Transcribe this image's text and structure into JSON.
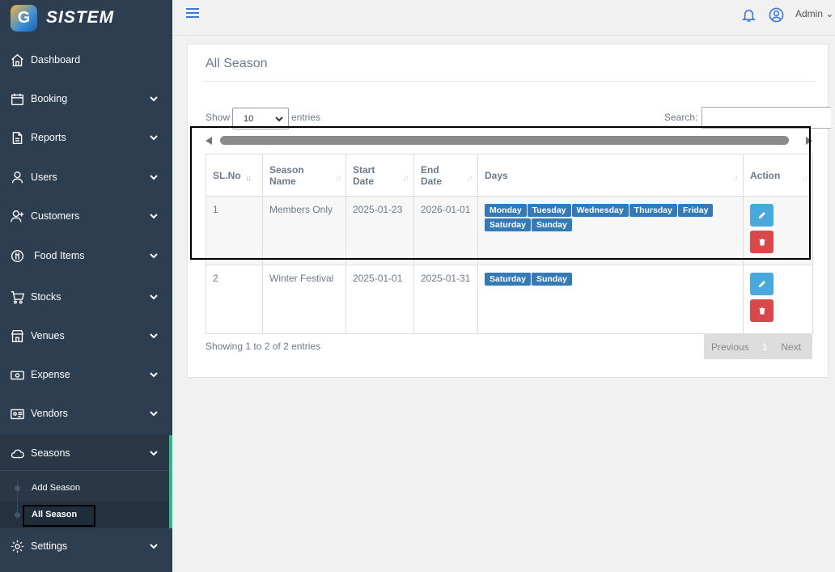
{
  "brand": {
    "logo_letter": "G",
    "name": "SISTEM"
  },
  "sidebar": {
    "items": [
      {
        "label": "Dashboard",
        "icon": "home-icon"
      },
      {
        "label": "Booking",
        "icon": "calendar-icon"
      },
      {
        "label": "Reports",
        "icon": "document-icon"
      },
      {
        "label": "Users",
        "icon": "user-icon"
      },
      {
        "label": "Customers",
        "icon": "user-plus-icon"
      },
      {
        "label": "Food Items",
        "icon": "food-icon"
      },
      {
        "label": "Stocks",
        "icon": "cart-icon"
      },
      {
        "label": "Venues",
        "icon": "store-icon"
      },
      {
        "label": "Expense",
        "icon": "money-icon"
      },
      {
        "label": "Vendors",
        "icon": "id-card-icon"
      },
      {
        "label": "Seasons",
        "icon": "cloud-icon"
      },
      {
        "label": "Settings",
        "icon": "gear-icon"
      }
    ],
    "seasons_sub": [
      "Add Season",
      "All Season"
    ]
  },
  "topbar": {
    "user_label": "Admin"
  },
  "page": {
    "title": "All Season",
    "show_label": "Show",
    "page_size": "10",
    "entries_label": "entries",
    "search_label": "Search:"
  },
  "table": {
    "headers": {
      "sl_no": "SL.No",
      "season_name_1": "Season",
      "season_name_2": "Name",
      "start_date_1": "Start",
      "start_date_2": "Date",
      "end_date_1": "End",
      "end_date_2": "Date",
      "days": "Days",
      "action": "Action"
    },
    "rows": [
      {
        "sl": "1",
        "name": "Members Only",
        "start": "2025-01-23",
        "end": "2026-01-01",
        "days": [
          "Monday",
          "Tuesday",
          "Wednesday",
          "Thursday",
          "Friday",
          "Saturday",
          "Sunday"
        ]
      },
      {
        "sl": "2",
        "name": "Winter Festival",
        "start": "2025-01-01",
        "end": "2025-01-31",
        "days": [
          "Saturday",
          "Sunday"
        ]
      }
    ]
  },
  "footer": {
    "info": "Showing 1 to 2 of 2 entries",
    "previous": "Previous",
    "current_page": "1",
    "next": "Next"
  },
  "colors": {
    "sidebar_bg": "#2e3e51",
    "accent": "#2fb88a",
    "badge": "#337ab7",
    "edit": "#4aa9dc",
    "delete": "#d9484b"
  }
}
